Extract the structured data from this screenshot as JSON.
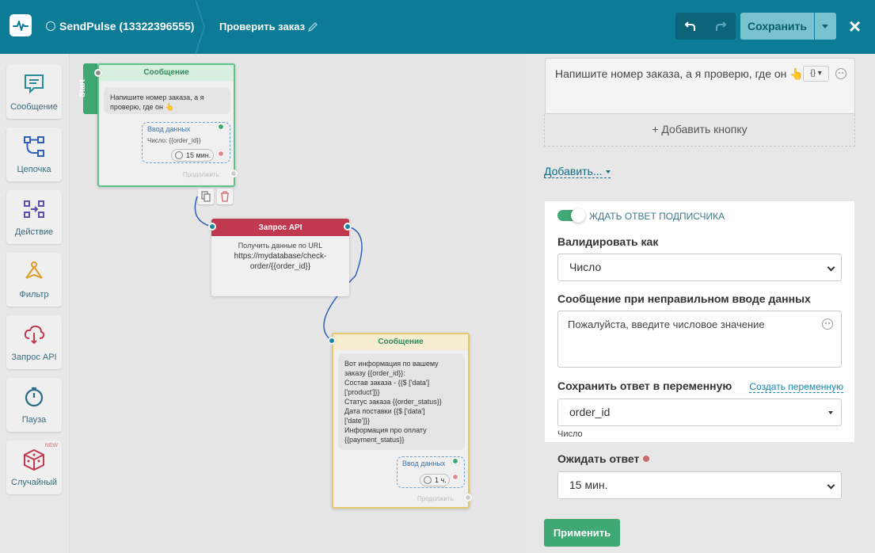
{
  "header": {
    "bot_name": "SendPulse (13322396555)",
    "flow_title": "Проверить заказ",
    "save_label": "Сохранить",
    "close_icon": "×"
  },
  "toolbar": {
    "items": [
      {
        "label": "Сообщение",
        "icon": "message-icon"
      },
      {
        "label": "Цепочка",
        "icon": "chain-icon"
      },
      {
        "label": "Действие",
        "icon": "action-icon"
      },
      {
        "label": "Фильтр",
        "icon": "filter-icon"
      },
      {
        "label": "Запрос API",
        "icon": "api-request-icon"
      },
      {
        "label": "Пауза",
        "icon": "pause-icon"
      },
      {
        "label": "Случайный",
        "icon": "random-dice-icon",
        "badge": "NEW"
      }
    ]
  },
  "canvas": {
    "start_label": "Start",
    "node1": {
      "title": "Сообщение",
      "text": "Напишите номер заказа, а я\nпроверю, где он 👆",
      "input_title": "Ввод данных",
      "input_var": "Число: {{order_id}}",
      "timer": "15 мин.",
      "continue": "Продолжить"
    },
    "node2": {
      "title": "Запрос API",
      "line1": "Получить данные по URL",
      "url": "https://mydatabase/check-\norder/{{order_id}}"
    },
    "node3": {
      "title": "Сообщение",
      "text": "Вот информация по вашему\nзаказу {{order_id}}:\nСостав заказа - {{$ ['data']\n['product']}}\nСтатус заказа {{order_status}}\nДата поставки {{$ ['data']\n['date']}}\nИнформация про оплату\n{{payment_status}}",
      "input_title": "Ввод данных",
      "timer": "1 ч.",
      "continue": "Продолжить"
    },
    "colors": {
      "green": "#3fa874",
      "api_red": "#c0394f",
      "yellow": "#e5c770",
      "wire": "#2f5fb8"
    }
  },
  "panel": {
    "message_text": "Напишите номер заказа, а я проверю, где он 👆",
    "insert_var_label": "{} ▾",
    "add_button_label": "+ Добавить кнопку",
    "add_menu_label": "Добавить...",
    "wait_toggle_label": "ЖДАТЬ ОТВЕТ ПОДПИСЧИКА",
    "wait_toggle_on": true,
    "validate_label": "Валидировать как",
    "validate_value": "Число",
    "error_msg_label": "Сообщение при неправильном вводе данных",
    "error_msg_value": "Пожалуйста, введите числовое значение",
    "save_var_label": "Сохранить ответ в переменную",
    "create_var_label": "Создать переменную",
    "save_var_value": "order_id",
    "save_var_type": "Число",
    "wait_answer_label": "Ожидать ответ",
    "wait_answer_value": "15 мин.",
    "apply_label": "Применить"
  }
}
